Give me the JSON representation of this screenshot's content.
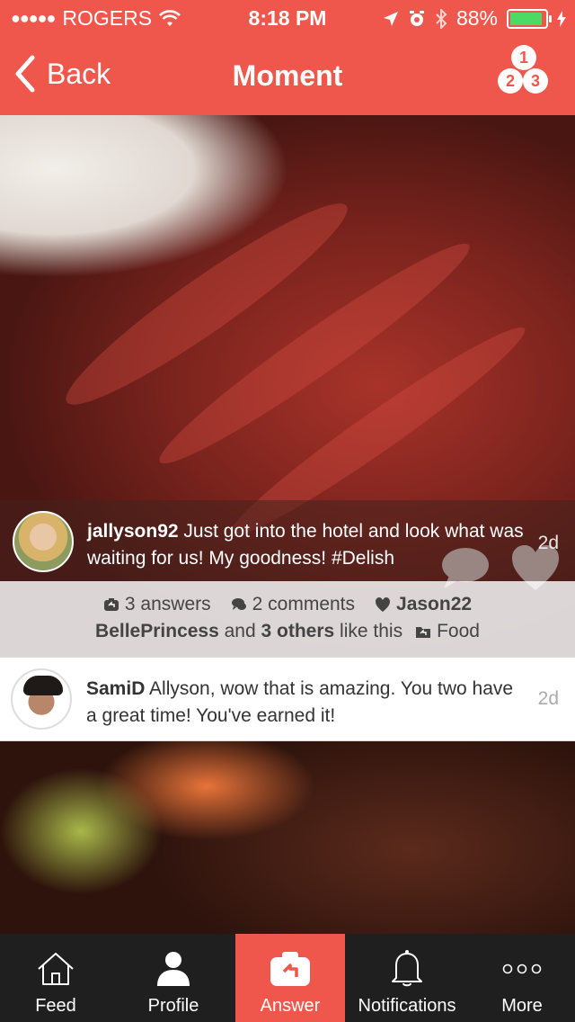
{
  "status_bar": {
    "carrier": "ROGERS",
    "signal_dots": "●●●●●",
    "time": "8:18 PM",
    "battery": "88%",
    "battery_level": 0.88
  },
  "nav": {
    "back_label": "Back",
    "title": "Moment",
    "logo_numbers": [
      "1",
      "2",
      "3"
    ]
  },
  "post": {
    "username": "jallyson92",
    "text": " Just got into the hotel and look what was waiting for us! My goodness! #Delish",
    "time": "2d"
  },
  "stats": {
    "answers": "3 answers",
    "comments": "2 comments",
    "liker": "Jason22",
    "liked_by_name": "BellePrincess",
    "liked_by_and": " and ",
    "liked_by_others": "3 others",
    "liked_by_suffix": " like this",
    "category": "Food"
  },
  "reply": {
    "username": "SamiD",
    "text": " Allyson, wow that is amazing. You two have a great time! You've earned it!",
    "time": "2d"
  },
  "tabs": [
    {
      "label": "Feed",
      "icon": "home-icon"
    },
    {
      "label": "Profile",
      "icon": "person-icon"
    },
    {
      "label": "Answer",
      "icon": "reply-camera-icon",
      "active": true
    },
    {
      "label": "Notifications",
      "icon": "bell-icon"
    },
    {
      "label": "More",
      "icon": "more-dots-icon"
    }
  ],
  "colors": {
    "accent": "#f0574c",
    "tabbar": "#1f1f1f"
  }
}
